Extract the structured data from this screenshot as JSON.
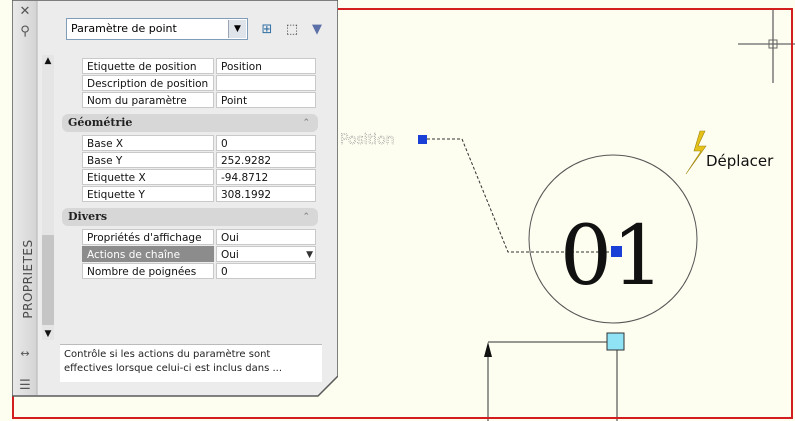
{
  "palette": {
    "title": "PROPRIETES",
    "selector": {
      "value": "Paramètre de point"
    },
    "sections": {
      "general": [
        {
          "name": "Etiquette de position",
          "value": "Position"
        },
        {
          "name": "Description de position",
          "value": ""
        },
        {
          "name": "Nom du paramètre",
          "value": "Point"
        }
      ],
      "geometry": {
        "title": "Géométrie",
        "rows": [
          {
            "name": "Base X",
            "value": "0"
          },
          {
            "name": "Base Y",
            "value": "252.9282"
          },
          {
            "name": "Etiquette X",
            "value": "-94.8712"
          },
          {
            "name": "Etiquette Y",
            "value": "308.1992"
          }
        ]
      },
      "misc": {
        "title": "Divers",
        "rows": [
          {
            "name": "Propriétés d'affichage",
            "value": "Oui"
          },
          {
            "name": "Actions de chaîne",
            "value": "Oui"
          },
          {
            "name": "Nombre de poignées",
            "value": "0"
          }
        ]
      }
    },
    "description_line1": "Contrôle si les actions du paramètre sont",
    "description_line2": "effectives lorsque celui-ci est inclus dans ..."
  },
  "drawing": {
    "position_label": "Position",
    "action_label": "Déplacer",
    "block_number": "01"
  },
  "colors": {
    "canvas_border": "#d21e1e",
    "canvas_bg": "#fdfdf0",
    "grip_blue": "#1a3fd6",
    "grip_cyan": "#8fe3f4",
    "lightning": "#e5c21a"
  }
}
